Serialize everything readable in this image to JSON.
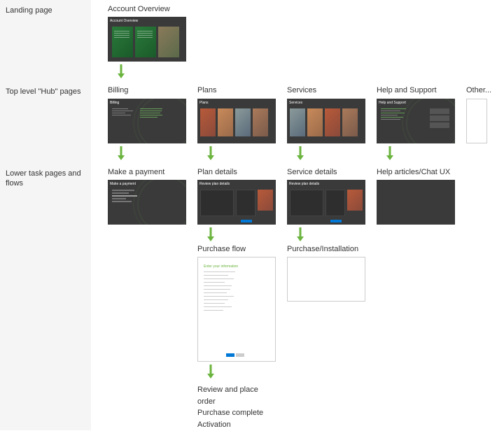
{
  "rows": {
    "landing": {
      "label": "Landing page"
    },
    "hub": {
      "label": "Top level \"Hub\" pages"
    },
    "lower": {
      "label": "Lower task pages and flows"
    }
  },
  "landing": {
    "account_overview": {
      "label": "Account Overview",
      "thumb_title": "Account Overview"
    }
  },
  "hub": {
    "billing": {
      "label": "Billing",
      "thumb_title": "Billing"
    },
    "plans": {
      "label": "Plans",
      "thumb_title": "Plans"
    },
    "services": {
      "label": "Services",
      "thumb_title": "Services"
    },
    "help": {
      "label": "Help and Support",
      "thumb_title": "Help and Support"
    },
    "other": {
      "label": "Other..."
    }
  },
  "lower": {
    "make_payment": {
      "label": "Make a payment",
      "thumb_title": "Make a payment"
    },
    "plan_details": {
      "label": "Plan details",
      "thumb_title": "Review plan details"
    },
    "service_details": {
      "label": "Service details",
      "thumb_title": "Review plan details"
    },
    "help_articles": {
      "label": "Help articles/Chat UX"
    },
    "purchase_flow": {
      "label": "Purchase flow",
      "thumb_title": "Enter your information"
    },
    "purchase_installation": {
      "label": "Purchase/Installation"
    },
    "end": {
      "line1": "Review and place order",
      "line2": "Purchase complete",
      "line3": "Activation"
    }
  },
  "colors": {
    "arrow": "#6bb43f"
  }
}
